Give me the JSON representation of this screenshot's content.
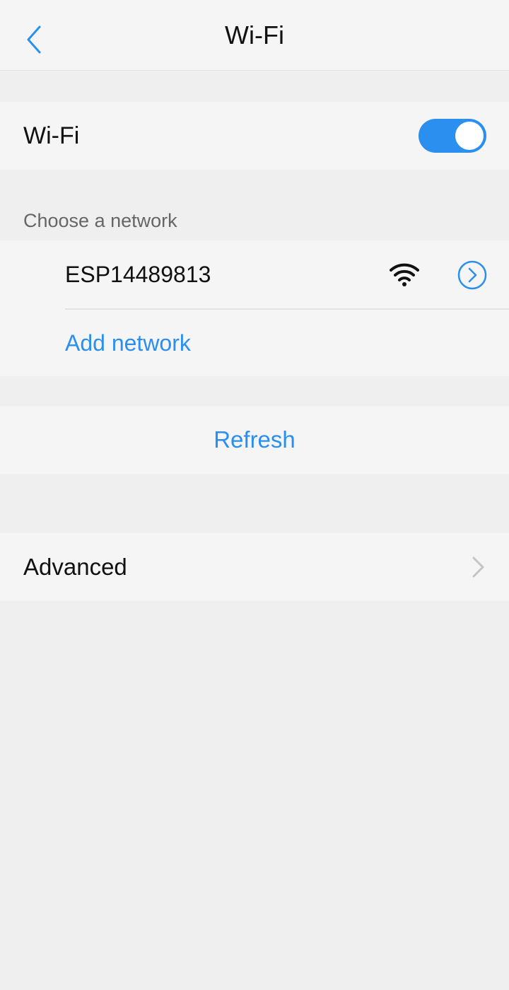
{
  "header": {
    "title": "Wi-Fi",
    "back_icon": "chevron-left-icon"
  },
  "wifi_toggle": {
    "label": "Wi-Fi",
    "enabled": true,
    "accent_color": "#2b8ff0"
  },
  "networks_section": {
    "label": "Choose a network",
    "networks": [
      {
        "name": "ESP14489813",
        "signal_icon": "wifi-signal-icon",
        "info_icon": "chevron-circle-right-icon"
      }
    ],
    "add_network_label": "Add network"
  },
  "refresh": {
    "label": "Refresh"
  },
  "advanced": {
    "label": "Advanced",
    "chevron_icon": "chevron-right-icon"
  }
}
